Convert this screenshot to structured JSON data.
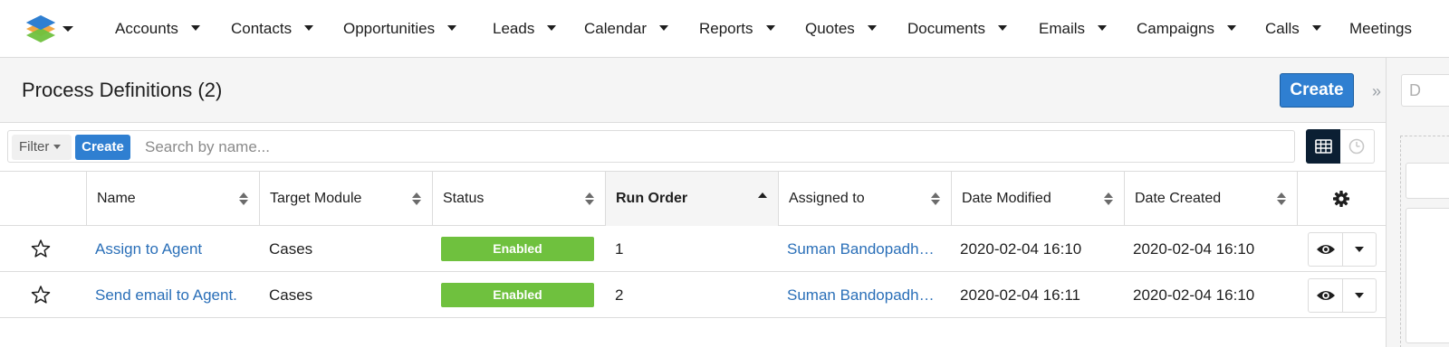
{
  "nav": {
    "logo_icon": "stacked-layers-logo-icon",
    "items": [
      {
        "label": "Accounts"
      },
      {
        "label": "Contacts"
      },
      {
        "label": "Opportunities"
      },
      {
        "label": "Leads"
      },
      {
        "label": "Calendar"
      },
      {
        "label": "Reports"
      },
      {
        "label": "Quotes"
      },
      {
        "label": "Documents"
      },
      {
        "label": "Emails"
      },
      {
        "label": "Campaigns"
      },
      {
        "label": "Calls"
      },
      {
        "label": "Meetings"
      }
    ]
  },
  "header": {
    "title": "Process Definitions (2)",
    "create_label": "Create",
    "collapse_icon": "double-chevron-right-icon"
  },
  "side_panel": {
    "input_value": "D"
  },
  "filter": {
    "filter_label": "Filter",
    "create_label": "Create",
    "search_placeholder": "Search by name...",
    "view_icons": [
      "list-view-icon",
      "activity-stream-icon"
    ]
  },
  "table": {
    "columns": [
      {
        "label": "Name",
        "sort": "none"
      },
      {
        "label": "Target Module",
        "sort": "none"
      },
      {
        "label": "Status",
        "sort": "none"
      },
      {
        "label": "Run Order",
        "sort": "ascending"
      },
      {
        "label": "Assigned to",
        "sort": "none"
      },
      {
        "label": "Date Modified",
        "sort": "none"
      },
      {
        "label": "Date Created",
        "sort": "none"
      }
    ],
    "settings_icon": "gear-icon",
    "rows": [
      {
        "name": "Assign to Agent",
        "target_module": "Cases",
        "status": "Enabled",
        "run_order": "1",
        "assigned_to": "Suman Bandopadh…",
        "date_modified": "2020-02-04 16:10",
        "date_created": "2020-02-04 16:10"
      },
      {
        "name": "Send email to Agent.",
        "target_module": "Cases",
        "status": "Enabled",
        "run_order": "2",
        "assigned_to": "Suman Bandopadh…",
        "date_modified": "2020-02-04 16:11",
        "date_created": "2020-02-04 16:10"
      }
    ]
  },
  "colors": {
    "primary": "#2f7fd1",
    "link": "#2a6fb8",
    "enabled": "#6fc13e",
    "dark_toggle": "#0b1f33"
  }
}
